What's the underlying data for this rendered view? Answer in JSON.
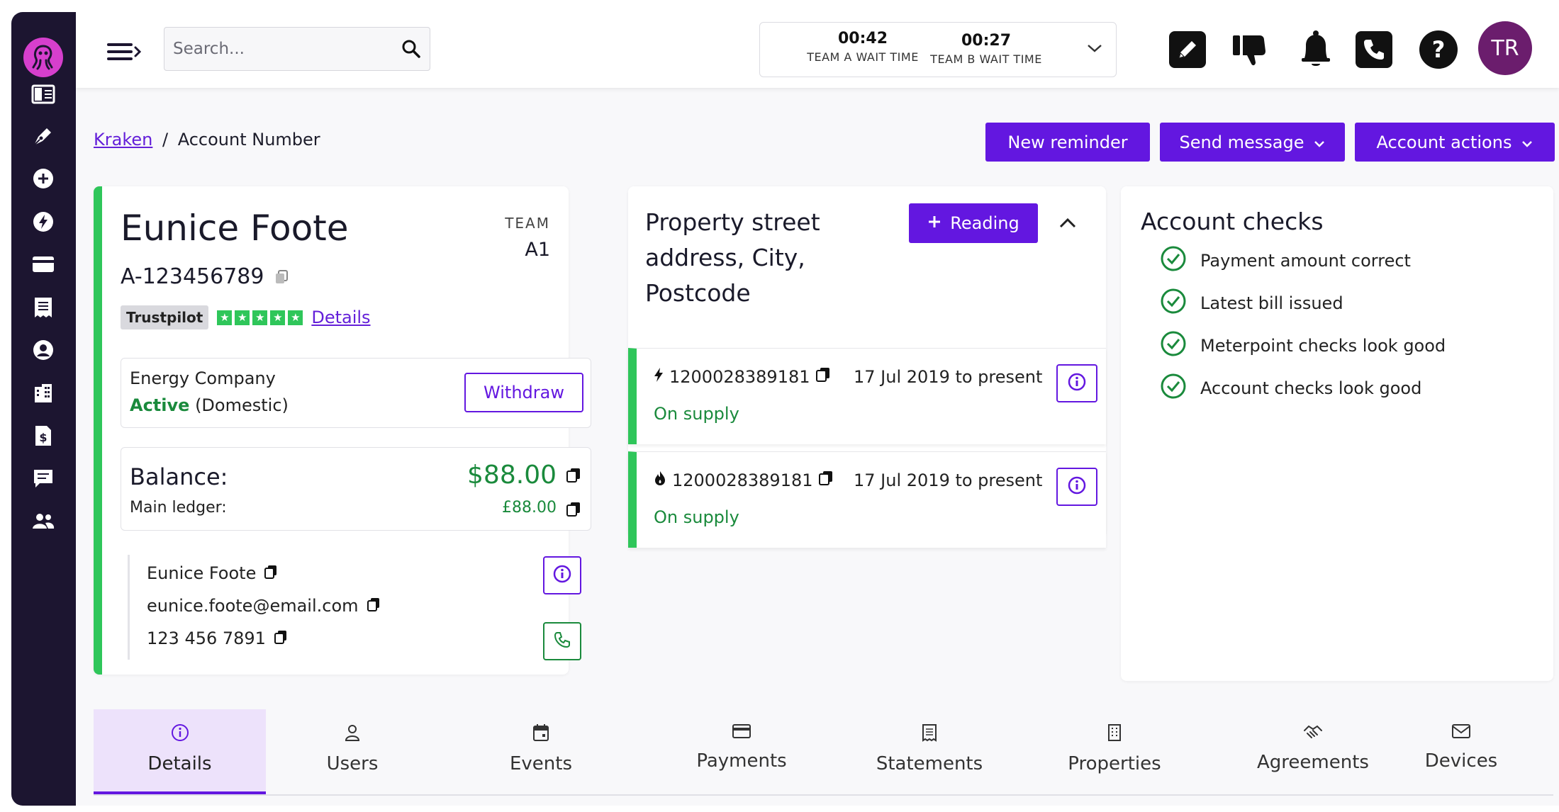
{
  "header": {
    "search_placeholder": "Search...",
    "team_a_time": "00:42",
    "team_a_label": "TEAM A WAIT TIME",
    "team_b_time": "00:27",
    "team_b_label": "TEAM B WAIT TIME",
    "avatar_initials": "TR"
  },
  "breadcrumb": {
    "root": "Kraken",
    "separator": "/",
    "current": "Account Number"
  },
  "actions": {
    "new_reminder": "New reminder",
    "send_message": "Send message",
    "account_actions": "Account actions"
  },
  "customer": {
    "name": "Eunice Foote",
    "account_number": "A-123456789",
    "team_label": "TEAM",
    "team_value": "A1",
    "trustpilot_label": "Trustpilot",
    "trustpilot_stars": 5,
    "trustpilot_link": "Details",
    "supplier": "Energy Company",
    "status_active": "Active",
    "status_type": "(Domestic)",
    "withdraw_label": "Withdraw",
    "balance_label": "Balance:",
    "balance_value": "$88.00",
    "ledger_label": "Main ledger:",
    "ledger_value": "£88.00",
    "contact_name": "Eunice Foote",
    "contact_email": "eunice.foote@email.com",
    "contact_phone": "123 456 7891"
  },
  "property": {
    "address": "Property street address, City, Postcode",
    "reading_label": "Reading",
    "meters": [
      {
        "type": "electricity",
        "id": "1200028389181",
        "dates": "17 Jul 2019 to present",
        "status": "On supply"
      },
      {
        "type": "gas",
        "id": "1200028389181",
        "dates": "17 Jul 2019 to present",
        "status": "On supply"
      }
    ]
  },
  "checks": {
    "title": "Account checks",
    "items": [
      "Payment amount correct",
      "Latest bill issued",
      "Meterpoint checks look good",
      "Account checks look good"
    ]
  },
  "tabs": [
    "Details",
    "Users",
    "Events",
    "Payments",
    "Statements",
    "Properties",
    "Agreements",
    "Devices"
  ],
  "colors": {
    "sidebar": "#1c1530",
    "accent": "#6317e0",
    "success": "#2fc65a",
    "success_text": "#1a8a3c",
    "logo": "#d63fcd",
    "avatar": "#6b1d6d"
  },
  "icons": {
    "sidebar": [
      "book-icon",
      "pen-icon",
      "plus-circle-icon",
      "bolt-icon",
      "credit-card-icon",
      "receipt-icon",
      "user-circle-icon",
      "building-icon",
      "dollar-file-icon",
      "chat-icon",
      "users-icon"
    ],
    "header": [
      "edit-icon",
      "thumbs-down-icon",
      "bell-icon",
      "phone-icon",
      "help-icon"
    ]
  }
}
